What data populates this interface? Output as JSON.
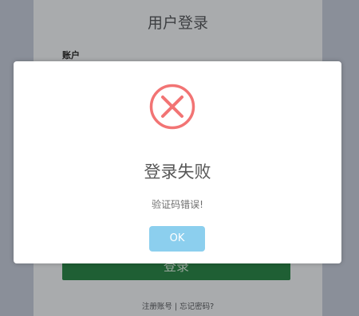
{
  "login": {
    "title": "用户登录",
    "account_label": "账户",
    "submit_label": "登录",
    "register_link": "注册账号",
    "separator": "|",
    "forgot_link": "忘记密码?"
  },
  "dialog": {
    "icon": "error-x-icon",
    "title": "登录失败",
    "message": "验证码错误!",
    "ok_label": "OK"
  },
  "colors": {
    "overlay": "#8a8f99",
    "error_icon": "#f27474",
    "ok_button": "#8ccfee",
    "submit_button": "#1f5f34"
  }
}
